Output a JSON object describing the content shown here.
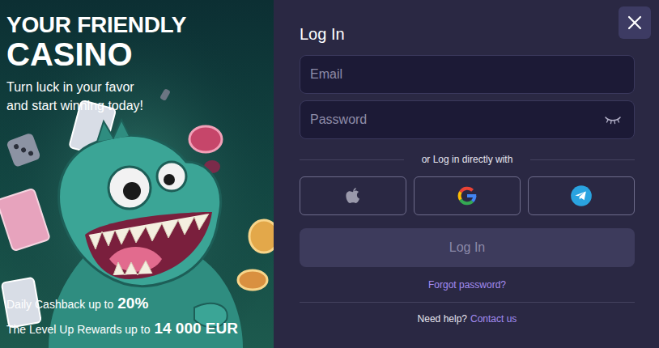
{
  "promo": {
    "title_line1": "YOUR FRIENDLY",
    "title_line2": "CASINO",
    "tagline_line1": "Turn luck in your favor",
    "tagline_line2": "and start winning today!",
    "cashback": {
      "label": "Daily Cashback up to",
      "value": "20%"
    },
    "rewards": {
      "label": "The Level Up Rewards up to",
      "value": "14 000 EUR"
    }
  },
  "login": {
    "title": "Log In",
    "email": {
      "placeholder": "Email"
    },
    "password": {
      "placeholder": "Password"
    },
    "divider": "or Log in directly with",
    "social": [
      {
        "kind": "apple"
      },
      {
        "kind": "google"
      },
      {
        "kind": "telegram"
      }
    ],
    "submit": {
      "label": "Log In",
      "disabled": true
    },
    "forgot": "Forgot password?",
    "help": {
      "text": "Need help?",
      "link": "Contact us"
    }
  }
}
